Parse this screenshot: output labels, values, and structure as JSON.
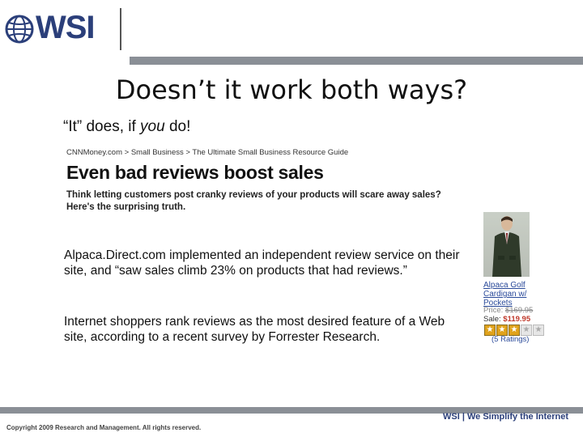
{
  "logo": {
    "wordmark": "WSI"
  },
  "slide": {
    "title": "Doesn’t it work both ways?",
    "subtitle_pre": "“It” does, if ",
    "subtitle_em": "you",
    "subtitle_post": " do!"
  },
  "clip": {
    "crumb_1": "CNNMoney.com",
    "crumb_sep_1": " > ",
    "crumb_2": "Small Business",
    "crumb_sep_2": " > ",
    "crumb_3": "The Ultimate Small Business Resource Guide",
    "headline": "Even bad reviews boost sales",
    "deck": "Think letting customers post cranky reviews of your products will scare away sales? Here's the surprising truth."
  },
  "body": {
    "para_1": "Alpaca.Direct.com implemented an independent review service on their site, and “saw sales climb 23% on products that had reviews.”",
    "para_2": "Internet shoppers rank reviews as the most desired feature of a Web site, according to a recent survey by Forrester Research."
  },
  "product": {
    "title": "Alpaca Golf Cardigan w/ Pockets",
    "price_label": "Price: ",
    "price_value": "$169.95",
    "sale_label": "Sale: ",
    "sale_value": "$119.95",
    "rating": 3,
    "rating_max": 5,
    "rating_count": "(5 Ratings)"
  },
  "footer": {
    "copyright": "Copyright 2009 Research and Management. All rights reserved.",
    "tagline": "WSI | We Simplify the Internet"
  },
  "colors": {
    "brand": "#2b3f7a",
    "bar": "#8a8f96",
    "star": "#e0a21b"
  }
}
